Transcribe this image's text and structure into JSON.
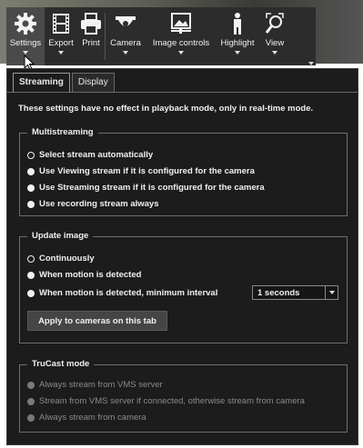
{
  "toolbar": {
    "items": [
      {
        "label": "Settings",
        "icon": "gear-icon"
      },
      {
        "label": "Export",
        "icon": "film-icon"
      },
      {
        "label": "Print",
        "icon": "printer-icon"
      },
      {
        "label": "Camera",
        "icon": "camera-icon"
      },
      {
        "label": "Image controls",
        "icon": "image-controls-icon"
      },
      {
        "label": "Highlight",
        "icon": "highlight-person-icon"
      },
      {
        "label": "View",
        "icon": "view-magnifier-icon"
      }
    ]
  },
  "tabs": {
    "streaming": "Streaming",
    "display": "Display"
  },
  "info_text": "These settings have no effect in playback mode, only in real-time mode.",
  "multistreaming": {
    "title": "Multistreaming",
    "options": [
      "Select stream automatically",
      "Use Viewing stream if it is configured for the camera",
      "Use Streaming stream if it is configured for the camera",
      "Use recording stream always"
    ]
  },
  "update_image": {
    "title": "Update image",
    "options": [
      "Continuously",
      "When motion is detected",
      "When motion is detected, minimum interval"
    ],
    "interval_value": "1 seconds",
    "apply_button": "Apply to cameras on this tab"
  },
  "trucast": {
    "title": "TruCast mode",
    "options": [
      "Always stream from VMS server",
      "Stream from VMS server if connected, otherwise stream from camera",
      "Always stream from camera"
    ]
  },
  "colors": {
    "panel_bg": "#1c1c1c",
    "toolbar_bg": "#2c2c2c",
    "text": "#f0f0f0",
    "disabled_text": "#8a8a8a"
  }
}
